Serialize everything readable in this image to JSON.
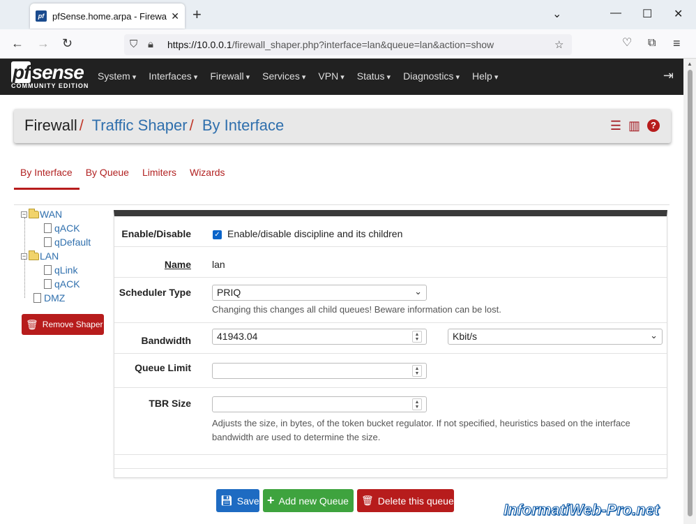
{
  "browser": {
    "tab_title": "pfSense.home.arpa - Firewall: Tr",
    "favicon": "pf",
    "url_host": "https://10.0.0.1",
    "url_path": "/firewall_shaper.php?interface=lan&queue=lan&action=show"
  },
  "nav": {
    "brand": "sense",
    "brand_prefix": "pf",
    "edition": "COMMUNITY EDITION",
    "menu": [
      "System",
      "Interfaces",
      "Firewall",
      "Services",
      "VPN",
      "Status",
      "Diagnostics",
      "Help"
    ]
  },
  "breadcrumb": {
    "root": "Firewall",
    "level1": "Traffic Shaper",
    "level2": "By Interface",
    "separator": "/"
  },
  "tabs": [
    "By Interface",
    "By Queue",
    "Limiters",
    "Wizards"
  ],
  "active_tab": "By Interface",
  "tree": {
    "wan": "WAN",
    "wan_children": [
      "qACK",
      "qDefault"
    ],
    "lan": "LAN",
    "lan_children": [
      "qLink",
      "qACK"
    ],
    "dmz": "DMZ"
  },
  "remove_shaper_label": "Remove Shaper",
  "form": {
    "enable_label": "Enable/Disable",
    "enable_text": "Enable/disable discipline and its children",
    "enable_checked": true,
    "name_label": "Name",
    "name_value": "lan",
    "scheduler_label": "Scheduler Type",
    "scheduler_value": "PRIQ",
    "scheduler_help": "Changing this changes all child queues! Beware information can be lost.",
    "bandwidth_label": "Bandwidth",
    "bandwidth_value": "41943.04",
    "bandwidth_unit": "Kbit/s",
    "queue_limit_label": "Queue Limit",
    "queue_limit_value": "",
    "tbr_label": "TBR Size",
    "tbr_value": "",
    "tbr_help": "Adjusts the size, in bytes, of the token bucket regulator. If not specified, heuristics based on the interface bandwidth are used to determine the size."
  },
  "buttons": {
    "save": "Save",
    "add_queue": "Add new Queue",
    "delete_queue": "Delete this queue"
  },
  "watermark": "InformatiWeb-Pro.net",
  "colors": {
    "accent_red": "#b71c1c",
    "link_blue": "#2f6fad",
    "nav_bg": "#212121",
    "save_blue": "#1e6bc2",
    "add_green": "#3ea33e"
  }
}
